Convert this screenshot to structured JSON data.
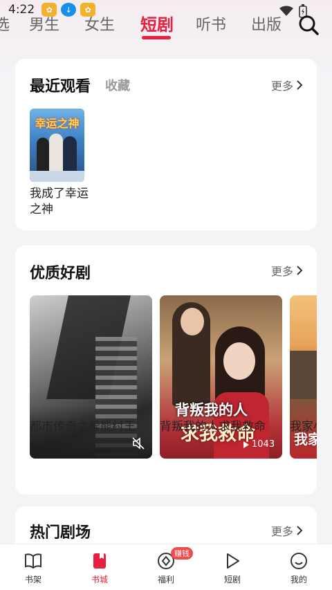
{
  "status_bar": {
    "time": "4:22"
  },
  "tabs": [
    {
      "label": "选"
    },
    {
      "label": "男生"
    },
    {
      "label": "女生"
    },
    {
      "label": "短剧"
    },
    {
      "label": "听书"
    },
    {
      "label": "出版"
    }
  ],
  "recent": {
    "title": "最近观看",
    "subtab": "收藏",
    "more": "更多",
    "items": [
      {
        "title": "我成了幸运之神",
        "cover_text": "幸运之神"
      }
    ]
  },
  "quality": {
    "title": "优质好剧",
    "more": "更多",
    "items": [
      {
        "title": "都市传奇之异能纣王"
      },
      {
        "title": "背叛我的人求我救命",
        "play_count": "1043",
        "poster_line1": "背叛我的人",
        "poster_line2": "求我救命"
      },
      {
        "title": "我家小",
        "poster_text": "我家"
      }
    ]
  },
  "hot": {
    "title": "热门剧场",
    "more": "更多"
  },
  "bottom_nav": {
    "items": [
      {
        "label": "书架"
      },
      {
        "label": "书城"
      },
      {
        "label": "福利"
      },
      {
        "label": "短剧"
      },
      {
        "label": "我的"
      }
    ],
    "badge": "赚钱"
  },
  "colors": {
    "accent": "#e8203f",
    "background": "#f4f3f6"
  }
}
